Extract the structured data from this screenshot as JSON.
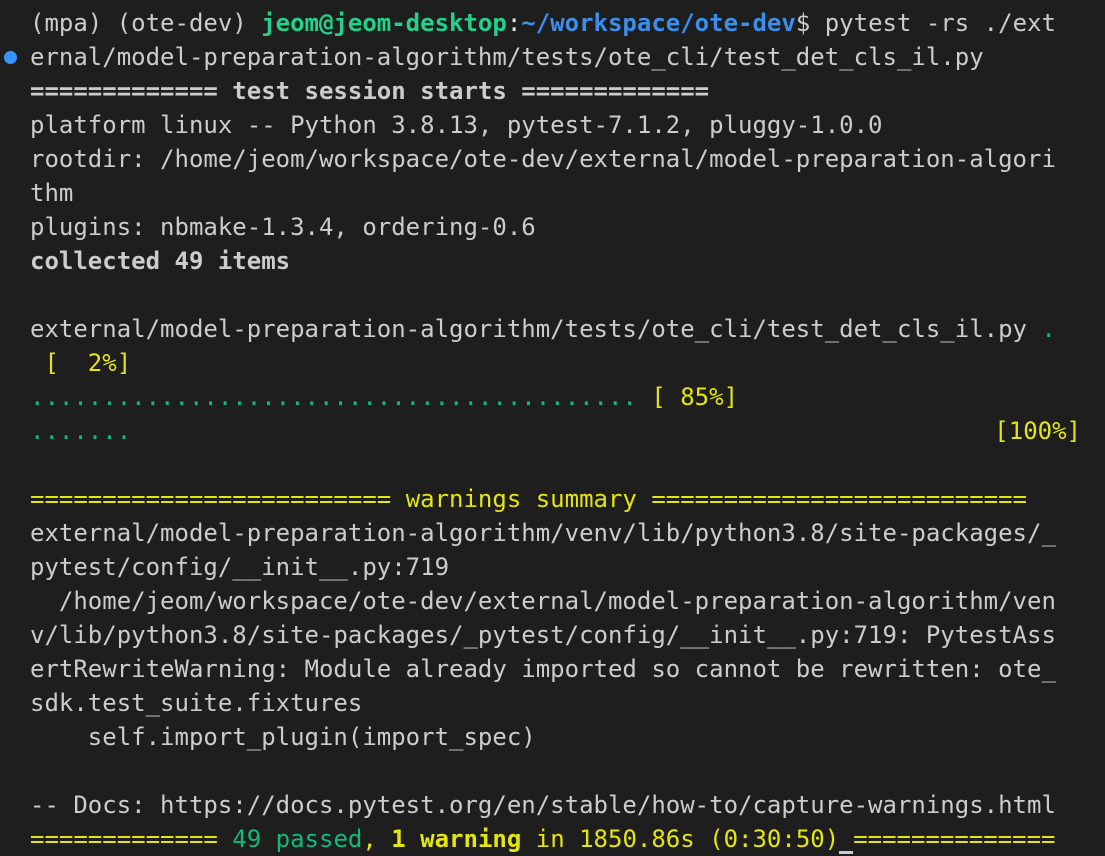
{
  "prompt": {
    "env": "(mpa) (ote-dev) ",
    "user_host": "jeom@jeom-desktop",
    "colon": ":",
    "path": "~/workspace/ote-dev",
    "dollar": "$ ",
    "command_part1": "pytest -rs ./ext",
    "command_part2": "ernal/model-preparation-algorithm/tests/ote_cli/test_det_cls_il.py"
  },
  "session": {
    "header": "============= test session starts =============",
    "platform": "platform linux -- Python 3.8.13, pytest-7.1.2, pluggy-1.0.0",
    "rootdir_1": "rootdir: /home/jeom/workspace/ote-dev/external/model-preparation-algori",
    "rootdir_2": "thm",
    "plugins": "plugins: nbmake-1.3.4, ordering-0.6",
    "collected": "collected 49 items"
  },
  "progress": {
    "test_file": "external/model-preparation-algorithm/tests/ote_cli/test_det_cls_il.py ",
    "first_dot": ".",
    "pct1": " [  2%]",
    "dots_line2": "..........................................",
    "pct2": " [ 85%]",
    "dots_line3": ".......",
    "pct3": "[100%]"
  },
  "warnings": {
    "header_left": "========================= ",
    "header_title": "warnings summary",
    "header_right": " ==========================",
    "location_1": "external/model-preparation-algorithm/venv/lib/python3.8/site-packages/_",
    "location_2": "pytest/config/__init__.py:719",
    "detail_1": "  /home/jeom/workspace/ote-dev/external/model-preparation-algorithm/ven",
    "detail_2": "v/lib/python3.8/site-packages/_pytest/config/__init__.py:719: PytestAss",
    "detail_3": "ertRewriteWarning: Module already imported so cannot be rewritten: ote_",
    "detail_4": "sdk.test_suite.fixtures",
    "detail_5": "    self.import_plugin(import_spec)",
    "docs": "-- Docs: https://docs.pytest.org/en/stable/how-to/capture-warnings.html"
  },
  "summary": {
    "left_rule": "============= ",
    "passed": "49 passed",
    "comma": ", ",
    "warning": "1 warning",
    "duration": " in 1850.86s (0:30:50)",
    "cursor_char": " ",
    "right_rule": "=============="
  },
  "colors": {
    "background": "#1e1e1e",
    "foreground": "#cccccc",
    "green": "#23d18b",
    "blue": "#3b8eea",
    "yellow": "#e5e510",
    "gutter_dot": "#3794ff"
  }
}
